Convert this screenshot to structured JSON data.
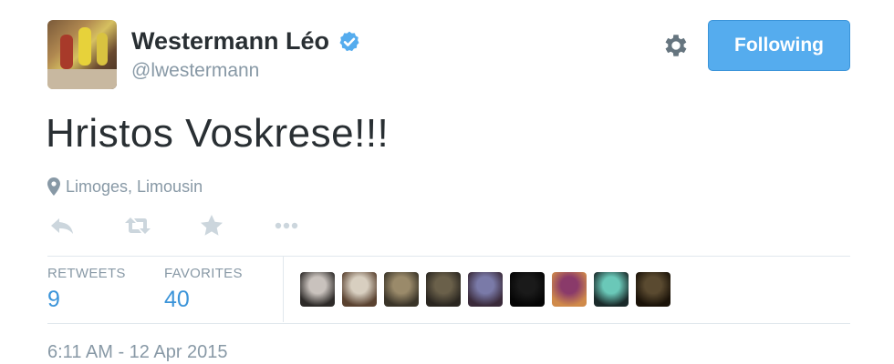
{
  "user": {
    "full_name": "Westermann Léo",
    "username": "@lwestermann",
    "verified": true,
    "avatar_icon": "basketball-players-photo"
  },
  "follow_button": {
    "label": "Following",
    "color": "#55acee"
  },
  "settings_icon": "gear-icon",
  "tweet": {
    "text": "Hristos Voskrese!!!",
    "location": "Limoges, Limousin",
    "timestamp": "6:11 AM - 12 Apr 2015"
  },
  "actions": [
    {
      "name": "reply-icon"
    },
    {
      "name": "retweet-icon"
    },
    {
      "name": "favorite-star-icon"
    },
    {
      "name": "more-options-icon"
    }
  ],
  "stats": {
    "retweets_label": "RETWEETS",
    "retweets_count": "9",
    "favorites_label": "FAVORITES",
    "favorites_count": "40"
  },
  "favoriters": [
    {
      "name": "favoriter-avatar-1",
      "colors": [
        "#c9c2bd",
        "#2d2a28"
      ]
    },
    {
      "name": "favoriter-avatar-2",
      "colors": [
        "#d8cfc0",
        "#5a4230"
      ]
    },
    {
      "name": "favoriter-avatar-3",
      "colors": [
        "#9a8a6a",
        "#3a3428"
      ]
    },
    {
      "name": "favoriter-avatar-4",
      "colors": [
        "#6a604a",
        "#2a2620"
      ]
    },
    {
      "name": "favoriter-avatar-5",
      "colors": [
        "#7a7aa8",
        "#3a2a3a"
      ]
    },
    {
      "name": "favoriter-avatar-6",
      "colors": [
        "#1a1a1a",
        "#050505"
      ]
    },
    {
      "name": "favoriter-avatar-7",
      "colors": [
        "#8a3a6a",
        "#d08a4a"
      ]
    },
    {
      "name": "favoriter-avatar-8",
      "colors": [
        "#6ac8b8",
        "#1a2a2a"
      ]
    },
    {
      "name": "favoriter-avatar-9",
      "colors": [
        "#5a4a30",
        "#1a1208"
      ]
    }
  ],
  "colors": {
    "accent": "#55acee",
    "link": "#3b94d9",
    "muted": "#8899a6",
    "verified_badge": "#55acee",
    "action_icon": "#ccd6dd"
  }
}
